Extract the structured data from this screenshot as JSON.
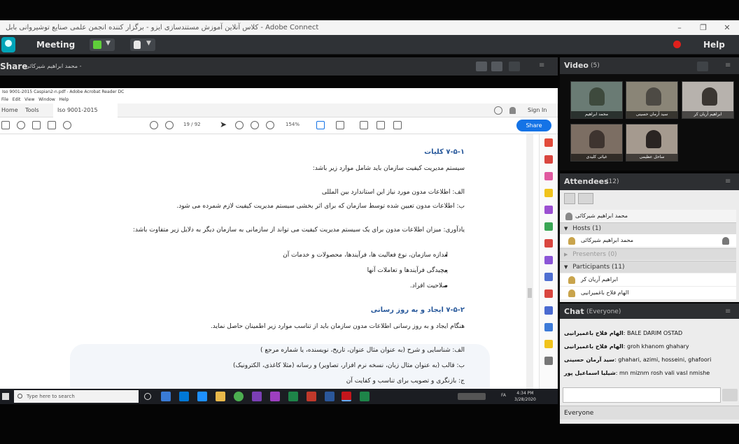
{
  "window": {
    "title": "کلاس آنلاین آموزش مستندسازی ایزو - برگزار کننده انجمن علمی صنایع توشیروانی بابل - Adobe Connect",
    "controls": [
      "–",
      "❐",
      "✕"
    ]
  },
  "toolbar": {
    "meeting_label": "Meeting",
    "help_label": "Help"
  },
  "share_pod": {
    "title": "Share",
    "presenter": "محمد ابراهیم شیرکائی -"
  },
  "acrobat": {
    "window_title": "Iso 9001-2015 Caspian2-n.pdf - Adobe Acrobat Reader DC",
    "menu": [
      "File",
      "Edit",
      "View",
      "Window",
      "Help"
    ],
    "tabs": [
      "Home",
      "Tools",
      "Iso 9001-2015 Casp...",
      "×"
    ],
    "sign_in": "Sign In",
    "page_indicator": "19 / 92",
    "zoom": "154%",
    "share_label": "Share"
  },
  "document": {
    "lines": [
      "۷-۵-۱ کلیات",
      "سیستم مدیریت کیفیت سازمان باید شامل موارد زیر باشد:",
      "الف: اطلاعات مدون مورد نیاز این استاندارد بین المللی",
      "ب: اطلاعات مدون تعیین شده توسط سازمان که برای اثر بخشی سیستم مدیریت کیفیت لازم شمرده می شود.",
      "یادآوری: میزان اطلاعات مدون برای یک سیستم مدیریت کیفیت می تواند از سازمانی به سازمان دیگر به دلایل زیر متفاوت باشد:",
      "اندازه سازمان، نوع فعالیت ها، فرآیندها، محصولات و خدمات آن",
      "پیچیدگی فرآیندها و تعاملات آنها",
      "صلاحیت افراد.",
      "۷-۵-۲ ایجاد و به روز رسانی",
      "هنگام ایجاد و به روز رسانی اطلاعات مدون سازمان باید از تناسب موارد زیر اطمینان حاصل نماید.",
      "الف: شناسایی و شرح (به عنوان مثال عنوان، تاریخ، نویسنده، یا شماره مرجع )",
      "ب: قالب (به عنوان مثال زبان، نسخه نرم افزار، تصاویر) و رسانه (مثلا کاغذی، الکترونیک)",
      "ج: بازنگری و تصویب برای تناسب و کفایت آن"
    ]
  },
  "taskbar": {
    "search_placeholder": "Type here to search",
    "time": "4:34 PM",
    "date": "3/28/2020"
  },
  "video_pod": {
    "title": "Video",
    "count": "(5)",
    "tiles": [
      "محمد ابراهیم",
      "سید آرمان حسینی",
      "ابراهیم آریان کر",
      "غیاثی کلیدی",
      "ساحل عظیمی"
    ]
  },
  "attendees_pod": {
    "title": "Attendees",
    "count": "(12)",
    "me": "محمد ابراهیم شیرکائی",
    "hosts_label": "Hosts (1)",
    "host": "محمد ابراهیم شیرکائی",
    "presenters_label": "Presenters (0)",
    "participants_label": "Participants (11)",
    "participants": [
      "ابراهیم آریان کر",
      "الهام فلاح باغمیرانیی"
    ]
  },
  "chat_pod": {
    "title": "Chat",
    "scope": "(Everyone)",
    "messages": [
      {
        "name": "الهام فلاح باغمیرانیی",
        "text": "BALE DARIM OSTAD"
      },
      {
        "name": "الهام فلاح باغمیرانیی",
        "text": "groh khanom ghahary"
      },
      {
        "name": "سید آرمان حسینی",
        "text": "ghahari, azimi, hosseini, ghafoori"
      },
      {
        "name": "شیلیا اسماعیل پور",
        "text": "mn miznm rosh vali vasl nmishe"
      }
    ],
    "recipient": "Everyone"
  },
  "colors": {
    "toolbar_bg": "#2f3236",
    "pod_header": "#2d2f32",
    "acrobat_blue": "#1473e6",
    "heading_blue": "#2a5a9c",
    "record_red": "#e0201c",
    "mic_green": "#5fcf3a"
  }
}
